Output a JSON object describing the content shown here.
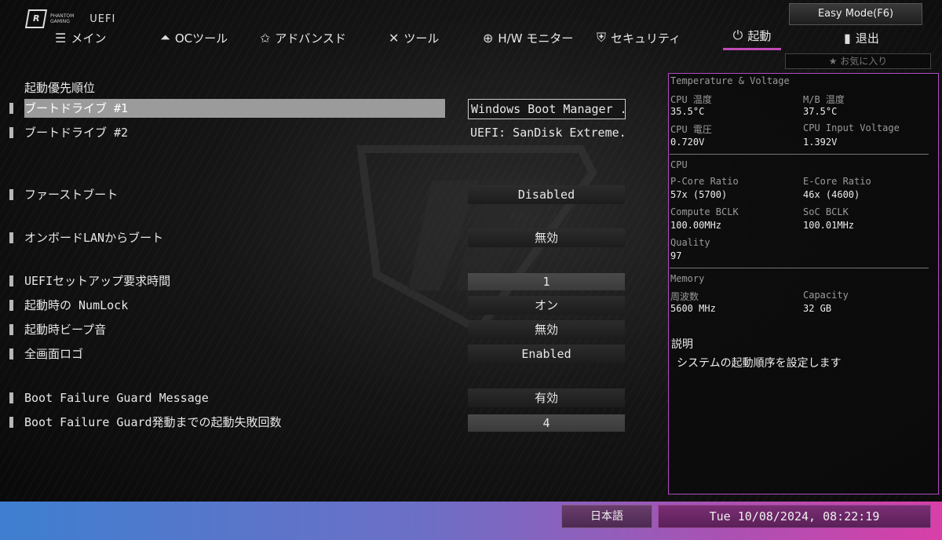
{
  "header": {
    "brand_line1": "PHANTOM",
    "brand_line2": "GAMING",
    "uefi": "UEFI",
    "easy_mode": "Easy Mode(F6)",
    "favorites": "★ お気に入り"
  },
  "nav": [
    {
      "label": "メイン",
      "icon": "grid-list-icon"
    },
    {
      "label": "OCツール",
      "icon": "rocket-icon"
    },
    {
      "label": "アドバンスド",
      "icon": "star-icon"
    },
    {
      "label": "ツール",
      "icon": "tools-icon"
    },
    {
      "label": "H/W モニター",
      "icon": "crosshair-icon"
    },
    {
      "label": "セキュリティ",
      "icon": "shield-icon"
    },
    {
      "label": "起動",
      "icon": "power-icon",
      "active": true
    },
    {
      "label": "退出",
      "icon": "exit-door-icon"
    }
  ],
  "section_title": "起動優先順位",
  "settings": [
    {
      "label": "ブートドライブ #1",
      "value": "Windows Boot Manager ...",
      "selected": true
    },
    {
      "label": "ブートドライブ #2",
      "value": "UEFI: SanDisk Extreme..."
    },
    {
      "label": "ファーストブート",
      "value": "Disabled"
    },
    {
      "label": "オンボードLANからブート",
      "value": "無効"
    },
    {
      "label": "UEFIセットアップ要求時間",
      "value": "1"
    },
    {
      "label": "起動時の NumLock",
      "value": "オン"
    },
    {
      "label": "起動時ビープ音",
      "value": "無効"
    },
    {
      "label": "全画面ロゴ",
      "value": "Enabled"
    },
    {
      "label": "Boot Failure Guard Message",
      "value": "有効"
    },
    {
      "label": "Boot Failure Guard発動までの起動失敗回数",
      "value": "4"
    }
  ],
  "monitor": {
    "tv_title": "Temperature & Voltage",
    "cpu_temp_label": "CPU 温度",
    "cpu_temp": "35.5°C",
    "mb_temp_label": "M/B 温度",
    "mb_temp": "37.5°C",
    "cpu_volt_label": "CPU 電圧",
    "cpu_volt": "0.720V",
    "cpu_input_label": "CPU Input Voltage",
    "cpu_input": "1.392V",
    "cpu_title": "CPU",
    "pcore_label": "P-Core Ratio",
    "pcore": "57x (5700)",
    "ecore_label": "E-Core Ratio",
    "ecore": "46x (4600)",
    "bclk_label": "Compute BCLK",
    "bclk": "100.00MHz",
    "soc_label": "SoC BCLK",
    "soc": "100.01MHz",
    "quality_label": "Quality",
    "quality": "97",
    "mem_title": "Memory",
    "freq_label": "周波数",
    "freq": "5600 MHz",
    "cap_label": "Capacity",
    "cap": "32 GB"
  },
  "description": {
    "title": "説明",
    "text": "システムの起動順序を設定します"
  },
  "footer": {
    "language": "日本語",
    "datetime": "Tue 10/08/2024, 08:22:19"
  },
  "colors": {
    "accent": "#b04cc0",
    "selected_row": "#9b9b9b"
  }
}
